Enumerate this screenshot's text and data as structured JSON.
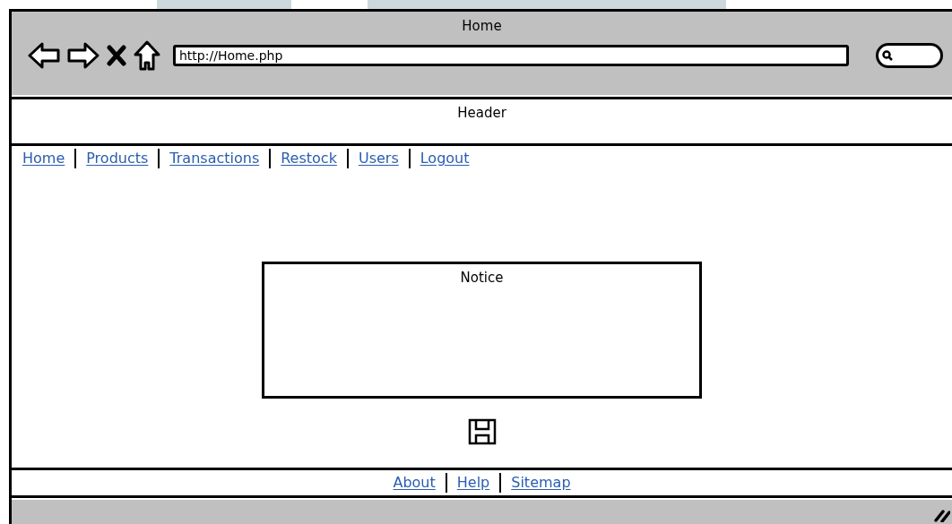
{
  "browser": {
    "title": "Home",
    "address": "http://Home.php"
  },
  "header": {
    "title": "Header"
  },
  "nav_links": [
    "Home",
    "Products",
    "Transactions",
    "Restock",
    "Users",
    "Logout"
  ],
  "notice": {
    "title": "Notice"
  },
  "footer_links": [
    "About",
    "Help",
    "Sitemap"
  ]
}
